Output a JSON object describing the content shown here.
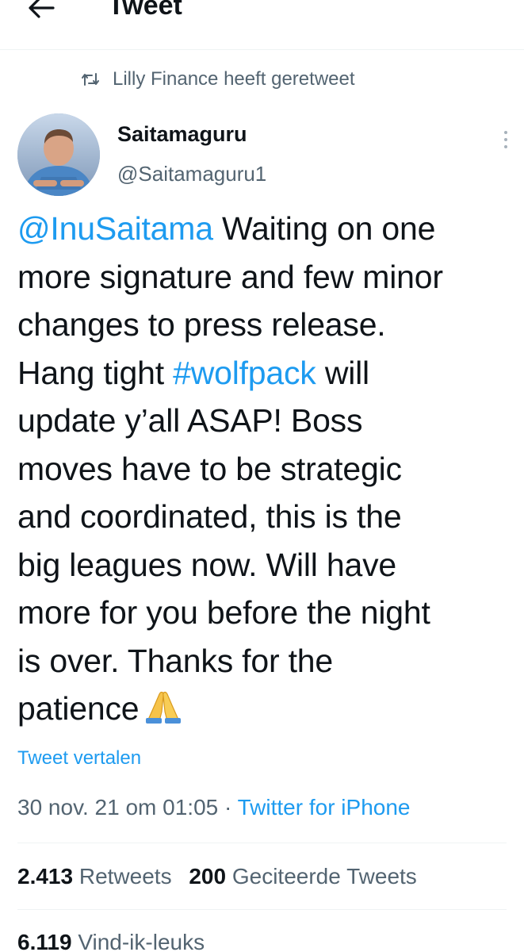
{
  "header": {
    "title": "Tweet"
  },
  "retweet_context": "Lilly Finance heeft geretweet",
  "author": {
    "name": "Saitamaguru",
    "handle": "@Saitamaguru1"
  },
  "tweet": {
    "lines": [
      [
        {
          "t": "@InuSaitama",
          "link": true
        },
        {
          "t": " Waiting on one"
        }
      ],
      [
        {
          "t": "more signature and few minor"
        }
      ],
      [
        {
          "t": "changes to press release."
        }
      ],
      [
        {
          "t": "Hang tight "
        },
        {
          "t": "#wolfpack",
          "link": true
        },
        {
          "t": " will"
        }
      ],
      [
        {
          "t": "update y’all ASAP! Boss"
        }
      ],
      [
        {
          "t": "moves have to be strategic"
        }
      ],
      [
        {
          "t": "and coordinated, this is the"
        }
      ],
      [
        {
          "t": "big leagues now. Will have"
        }
      ],
      [
        {
          "t": "more for you before the night"
        }
      ],
      [
        {
          "t": "is over. Thanks for the"
        }
      ],
      [
        {
          "t": "patience"
        }
      ]
    ],
    "emoji": "folded-hands",
    "translate_label": "Tweet vertalen",
    "date": "30 nov. 21 om 01:05",
    "separator": " · ",
    "source": "Twitter for iPhone"
  },
  "stats": {
    "retweets_count": "2.413",
    "retweets_label": "Retweets",
    "quotes_count": "200",
    "quotes_label": "Geciteerde Tweets",
    "likes_count": "6.119",
    "likes_label": "Vind-ik-leuks"
  },
  "colors": {
    "link": "#1d9bf0",
    "secondary_text": "#536471",
    "primary_text": "#0f1419",
    "divider": "#eff3f4"
  }
}
